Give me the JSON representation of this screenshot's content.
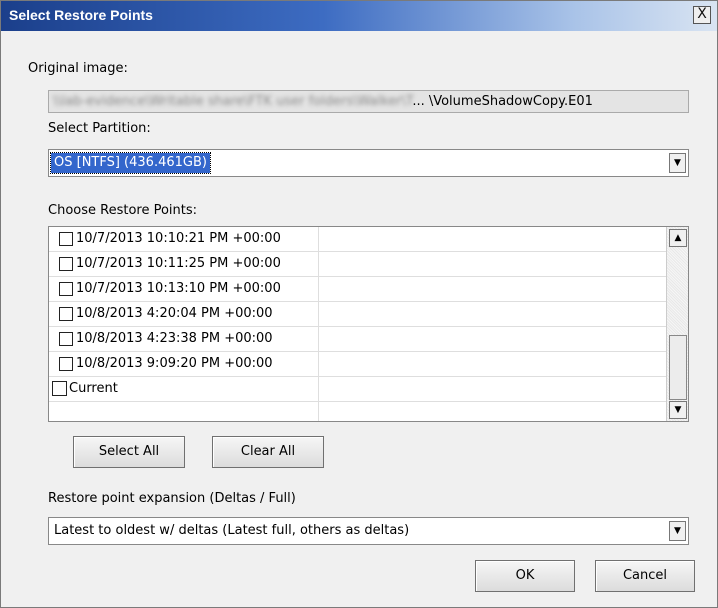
{
  "window": {
    "title": "Select Restore Points",
    "close_glyph": "X"
  },
  "original_image": {
    "label": "Original image:",
    "path_obscured": "\\\\lab-evidence\\Writable share\\FTK user folders\\Walker\\T",
    "path_suffix": "... \\VolumeShadowCopy.E01"
  },
  "partition": {
    "label": "Select Partition:",
    "selected": "OS [NTFS] (436.461GB)"
  },
  "restore_points": {
    "label": "Choose Restore Points:",
    "items": [
      {
        "label": "10/7/2013 10:10:21 PM +00:00",
        "checked": false
      },
      {
        "label": "10/7/2013 10:11:25 PM +00:00",
        "checked": false
      },
      {
        "label": "10/7/2013 10:13:10 PM +00:00",
        "checked": false
      },
      {
        "label": "10/8/2013 4:20:04 PM +00:00",
        "checked": false
      },
      {
        "label": "10/8/2013 4:23:38 PM +00:00",
        "checked": false
      },
      {
        "label": "10/8/2013 9:09:20 PM +00:00",
        "checked": false
      },
      {
        "label": "Current",
        "checked": false
      }
    ]
  },
  "buttons": {
    "select_all": "Select All",
    "clear_all": "Clear All",
    "ok": "OK",
    "cancel": "Cancel"
  },
  "expansion": {
    "label": "Restore point expansion (Deltas / Full)",
    "selected": "Latest to oldest w/ deltas (Latest full, others as deltas)"
  },
  "icons": {
    "scroll_up": "up-arrow-icon",
    "scroll_down": "down-arrow-icon",
    "dropdown": "dropdown-arrow-icon"
  },
  "colors": {
    "title_bar_start": "#1b3f8b",
    "title_bar_end": "#d9e4f2",
    "selection": "#3366cc"
  }
}
